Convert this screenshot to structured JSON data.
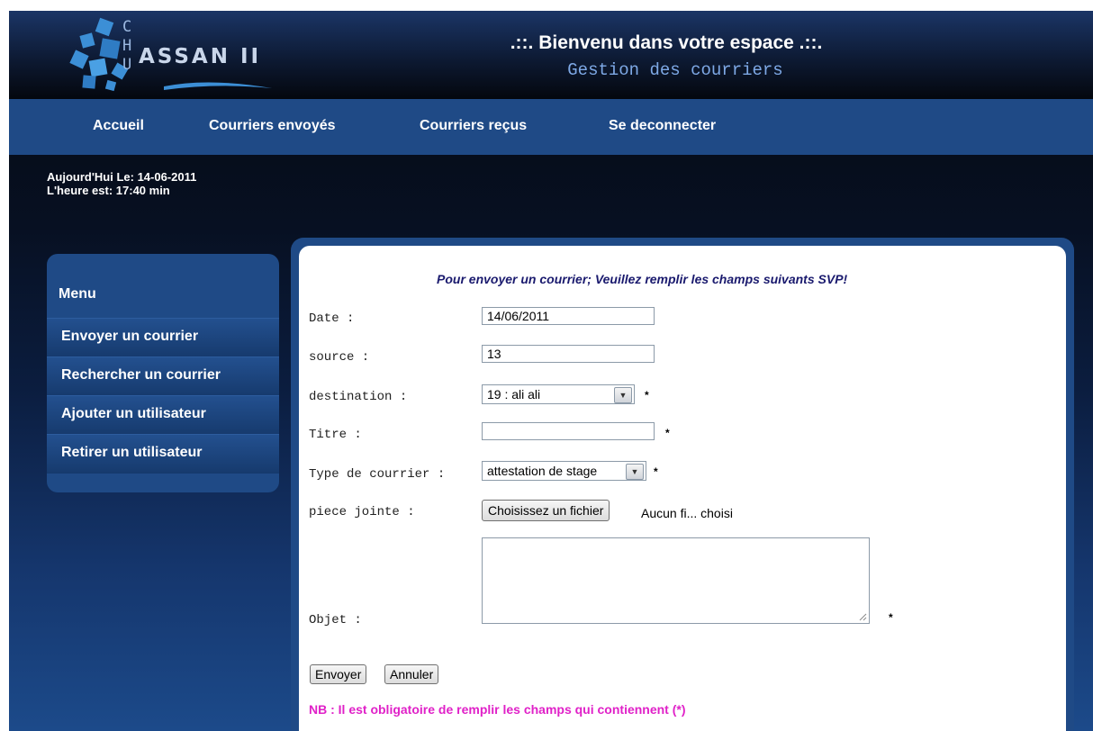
{
  "header": {
    "logo_letters": "C H U",
    "logo_name": "ASSAN II",
    "welcome": ".::. Bienvenu dans votre espace .::.",
    "subtitle": "Gestion des courriers"
  },
  "nav": {
    "items": [
      {
        "label": "Accueil"
      },
      {
        "label": "Courriers envoyés"
      },
      {
        "label": "Courriers reçus"
      },
      {
        "label": "Se deconnecter"
      }
    ]
  },
  "info": {
    "date_line": "Aujourd'Hui Le: 14-06-2011",
    "time_line": "L'heure est: 17:40 min"
  },
  "sidebar": {
    "title": "Menu",
    "items": [
      {
        "label": "Envoyer un courrier"
      },
      {
        "label": "Rechercher un courrier"
      },
      {
        "label": "Ajouter un utilisateur"
      },
      {
        "label": "Retirer un utilisateur"
      }
    ]
  },
  "form": {
    "intro": "Pour envoyer un courrier; Veuillez remplir les champs suivants SVP!",
    "required_mark": "*",
    "fields": {
      "date": {
        "label": "Date :",
        "value": "14/06/2011"
      },
      "source": {
        "label": "source :",
        "value": "13"
      },
      "destination": {
        "label": "destination :",
        "value": "19 : ali ali"
      },
      "titre": {
        "label": "Titre :",
        "value": ""
      },
      "type": {
        "label": "Type de courrier :",
        "value": "attestation de stage"
      },
      "piece": {
        "label": "piece jointe :",
        "button": "Choisissez un fichier",
        "status": "Aucun fi... choisi"
      },
      "objet": {
        "label": "Objet :",
        "value": ""
      }
    },
    "submit_label": "Envoyer",
    "cancel_label": "Annuler",
    "note": "NB : Il est obligatoire de remplir les champs qui contiennent (*)"
  },
  "colors": {
    "nav_bar": "#1f4a86",
    "subtitle": "#7ea9e6",
    "note": "#e021c8"
  }
}
